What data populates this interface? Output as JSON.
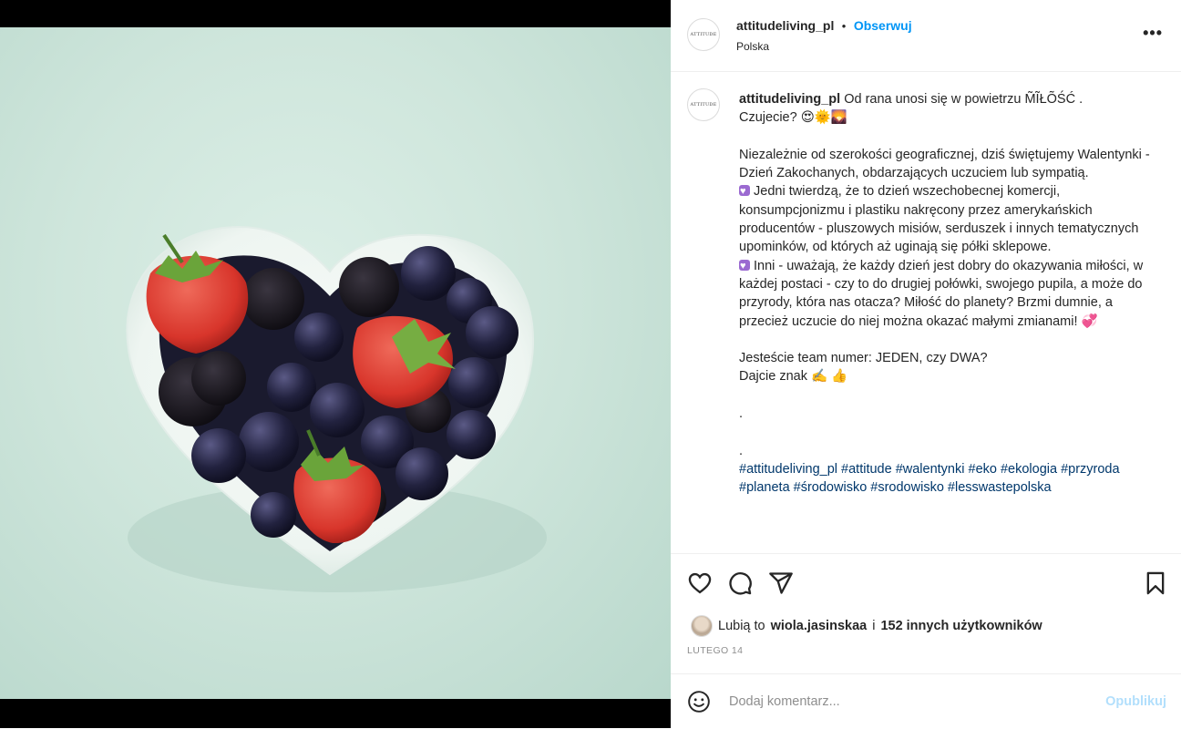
{
  "post": {
    "username": "attitudeliving_pl",
    "separator": "•",
    "follow_label": "Obserwuj",
    "location": "Polska",
    "more_label": "•••",
    "avatar_text": "ATTITUDE"
  },
  "caption": {
    "username": "attitudeliving_pl",
    "line1": " Od rana unosi się w powietrzu M̃ĨŁÕŚĆ .",
    "line2": "Czujecie? 😍🌞🌄",
    "para1": "Niezależnie od szerokości geograficznej, dziś świętujemy Walentynki - Dzień Zakochanych, obdarzających uczuciem lub sympatią.",
    "para2": " Jedni twierdzą, że to dzień wszechobecnej komercji, konsumpcjonizmu i plastiku nakręcony przez amerykańskich producentów - pluszowych misiów, serduszek i innych tematycznych upominków, od których aż uginają się półki sklepowe.",
    "para3": " Inni - uważają, że każdy dzień jest dobry do okazywania miłości, w każdej postaci - czy to do drugiej połówki, swojego pupila, a może do przyrody, która nas otacza? Miłość do planety? Brzmi dumnie, a przecież uczucie do niej można okazać małymi zmianami! 💞",
    "question": "Jesteście team numer: JEDEN, czy DWA?",
    "cta": "Dajcie znak ✍️ 👍",
    "dot1": ".",
    "dot2": ".",
    "hashtags": "#attitudeliving_pl #attitude #walentynki #eko #ekologia #przyroda #planeta #środowisko #srodowisko #lesswastepolska"
  },
  "likes": {
    "prefix": "Lubią to",
    "user": "wiola.jasinskaa",
    "connector": "i",
    "others": "152 innych użytkowników"
  },
  "date": "LUTEGO 14",
  "comment": {
    "placeholder": "Dodaj komentarz...",
    "post_label": "Opublikuj"
  },
  "icons": [
    "heart-icon",
    "comment-icon",
    "share-icon",
    "bookmark-icon",
    "emoji-icon",
    "more-icon"
  ]
}
